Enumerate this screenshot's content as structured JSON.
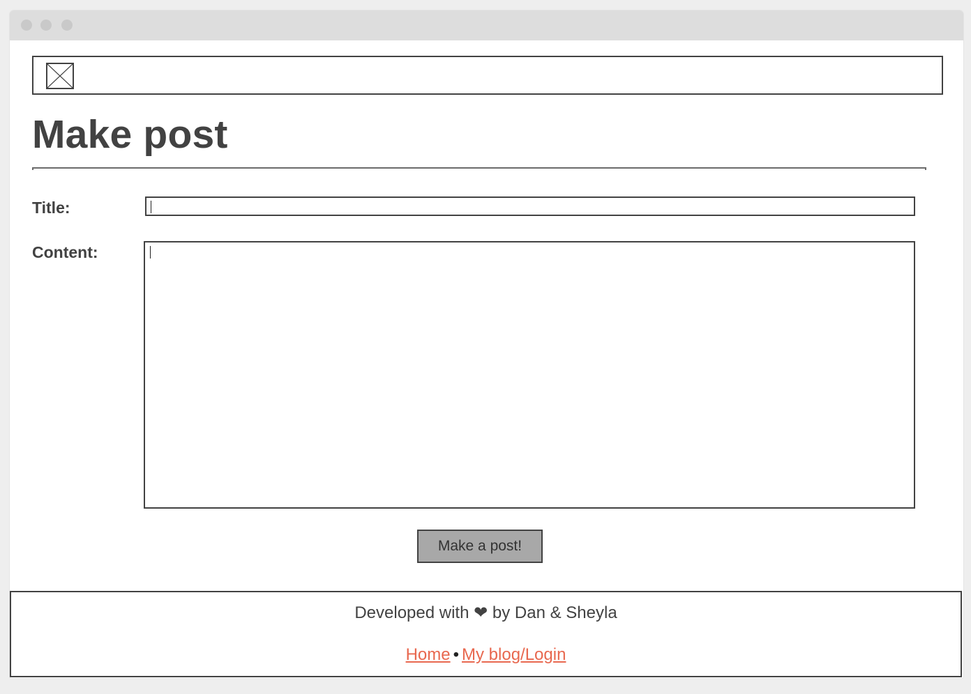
{
  "page": {
    "title": "Make post"
  },
  "header": {
    "logo_icon": "broken-image-placeholder"
  },
  "form": {
    "title_label": "Title:",
    "title_value": "",
    "content_label": "Content:",
    "content_value": "",
    "submit_label": "Make a post!"
  },
  "footer": {
    "credit_prefix": "Developed with",
    "heart": "❤",
    "credit_suffix": "by Dan & Sheyla",
    "links": [
      {
        "label": "Home"
      },
      {
        "label": "My blog/Login"
      }
    ],
    "separator": "•"
  },
  "colors": {
    "link": "#e8684f",
    "text": "#424242",
    "button_bg": "#a8a8a8"
  }
}
